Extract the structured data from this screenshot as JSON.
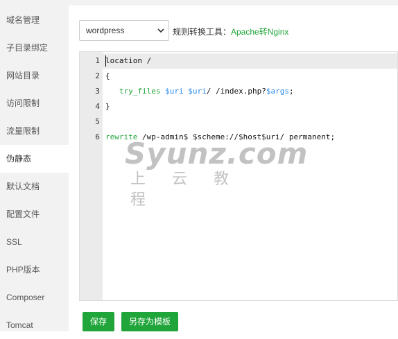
{
  "sidebar": {
    "items": [
      {
        "label": "域名管理"
      },
      {
        "label": "子目录绑定"
      },
      {
        "label": "网站目录"
      },
      {
        "label": "访问限制"
      },
      {
        "label": "流量限制"
      },
      {
        "label": "伪静态",
        "active": true
      },
      {
        "label": "默认文档"
      },
      {
        "label": "配置文件"
      },
      {
        "label": "SSL"
      },
      {
        "label": "PHP版本"
      },
      {
        "label": "Composer"
      },
      {
        "label": "Tomcat"
      }
    ]
  },
  "toolbar": {
    "template_select_value": "wordpress",
    "tool_label": "规则转换工具：",
    "tool_link": "Apache转Nginx"
  },
  "editor": {
    "line_numbers": [
      "1",
      "2",
      "3",
      "4",
      "5",
      "6"
    ],
    "active_line": 1
  },
  "watermark": {
    "text": "Syunz.com",
    "subtext": "上云教程"
  },
  "buttons": {
    "save": "保存",
    "save_as_template": "另存为模板"
  },
  "colors": {
    "accent": "#20a53a",
    "sidebar_bg": "#f2f2f2",
    "gutter_bg": "#ebebeb",
    "variable": "#2d8cf0"
  }
}
